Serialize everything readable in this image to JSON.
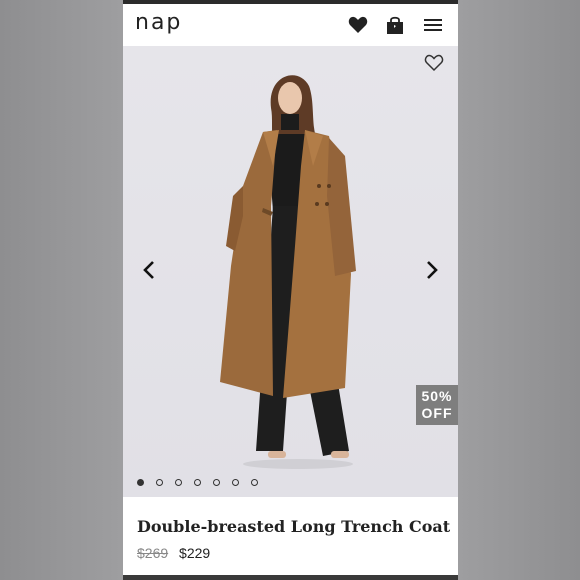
{
  "header": {
    "logo": "nap",
    "icons": [
      "heart-icon",
      "shopping-bag-icon",
      "menu-icon"
    ]
  },
  "gallery": {
    "image_alt": "Model wearing a brown double-breasted long trench coat over black outfit",
    "badge_line1": "50%",
    "badge_line2": "OFF",
    "slide_count": 7,
    "active_slide": 1
  },
  "product": {
    "title": "Double-breasted Long Trench Coat",
    "original_price": "$269",
    "sale_price": "$229"
  },
  "colors": {
    "coat": "#9b6a3c",
    "badge_bg": "#7e7e7e",
    "photo_bg": "#e4e3e8"
  }
}
